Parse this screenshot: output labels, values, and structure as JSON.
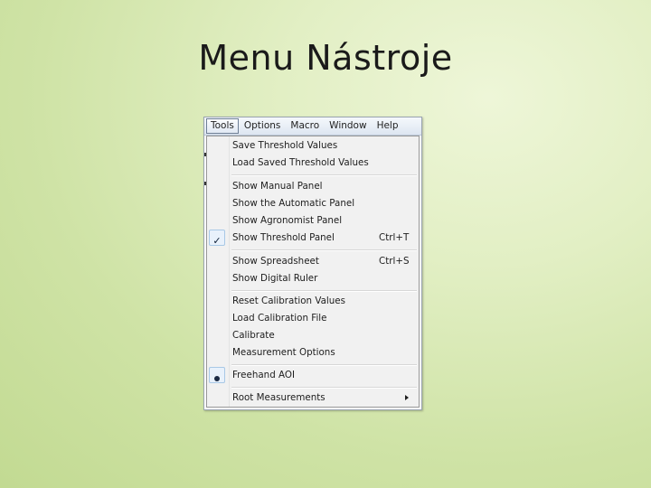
{
  "slide": {
    "title": "Menu Nástroje"
  },
  "menubar": {
    "items": [
      {
        "label": "Tools",
        "active": true
      },
      {
        "label": "Options",
        "active": false
      },
      {
        "label": "Macro",
        "active": false
      },
      {
        "label": "Window",
        "active": false
      },
      {
        "label": "Help",
        "active": false
      }
    ]
  },
  "tools_menu": {
    "items": [
      {
        "label": "Save Threshold Values",
        "shortcut": ""
      },
      {
        "label": "Load Saved Threshold Values",
        "shortcut": ""
      },
      {
        "label": "Show Manual Panel",
        "shortcut": ""
      },
      {
        "label": "Show the Automatic Panel",
        "shortcut": ""
      },
      {
        "label": "Show Agronomist Panel",
        "shortcut": ""
      },
      {
        "label": "Show Threshold Panel",
        "shortcut": "Ctrl+T",
        "checked": true
      },
      {
        "label": "Show Spreadsheet",
        "shortcut": "Ctrl+S"
      },
      {
        "label": "Show Digital Ruler",
        "shortcut": ""
      },
      {
        "label": "Reset Calibration Values",
        "shortcut": ""
      },
      {
        "label": "Load Calibration File",
        "shortcut": ""
      },
      {
        "label": "Calibrate",
        "shortcut": ""
      },
      {
        "label": "Measurement Options",
        "shortcut": ""
      },
      {
        "label": "Freehand AOI",
        "shortcut": "",
        "selected": true
      },
      {
        "label": "Root Measurements",
        "shortcut": "",
        "submenu": true
      }
    ],
    "check_glyph": "✓"
  },
  "colors": {
    "background": "#d4e6ad",
    "menu_background": "#f1f1f1",
    "highlight_box": "#e8f1fb"
  }
}
